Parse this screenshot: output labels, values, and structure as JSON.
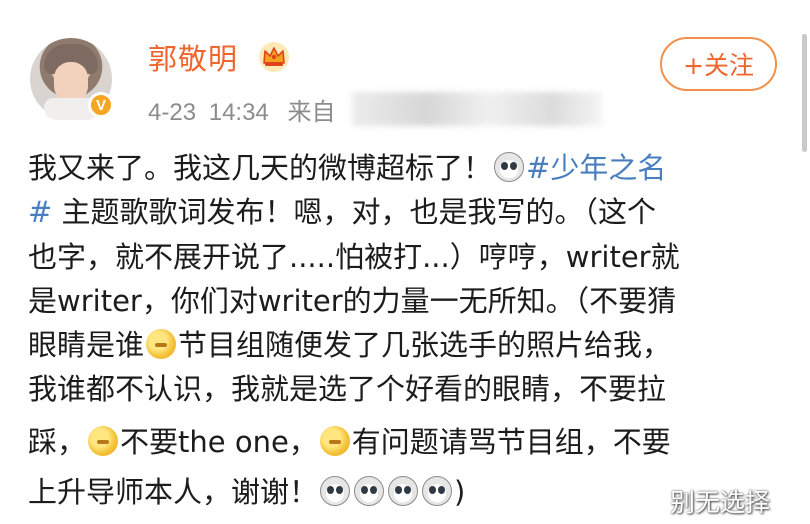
{
  "header": {
    "username": "郭敬明",
    "crown_icon": "crown-icon",
    "verified_badge": "V",
    "date": "4-23",
    "time": "14:34",
    "source_prefix": "来自",
    "follow_label": "+关注"
  },
  "post": {
    "lines": [
      {
        "parts": [
          "我又来了。我这几天的微博超标了！",
          "#少年之名"
        ]
      },
      {
        "parts": [
          "#",
          "主题歌歌词发布！嗯，对，也是我写的。（这个"
        ]
      },
      {
        "parts": [
          "也字，就不展开说了.....怕被打...）哼哼，writer就"
        ]
      },
      {
        "parts": [
          "是writer，你们对writer的力量一无所知。（不要猜"
        ]
      },
      {
        "parts": [
          "眼睛是谁",
          "节目组随便发了几张选手的照片给我，"
        ]
      },
      {
        "parts": [
          "我谁都不认识，我就是选了个好看的眼睛，不要拉"
        ]
      },
      {
        "parts": [
          "踩，",
          "不要the one，",
          "有问题请骂节目组，不要"
        ]
      },
      {
        "parts": [
          "上升导师本人，谢谢！",
          ")"
        ]
      }
    ]
  },
  "watermark": "别无选择",
  "colors": {
    "username": "#f0652c",
    "hashtag": "#4a7fbf",
    "follow_border": "#f0914a",
    "meta": "#8c8c8c"
  }
}
